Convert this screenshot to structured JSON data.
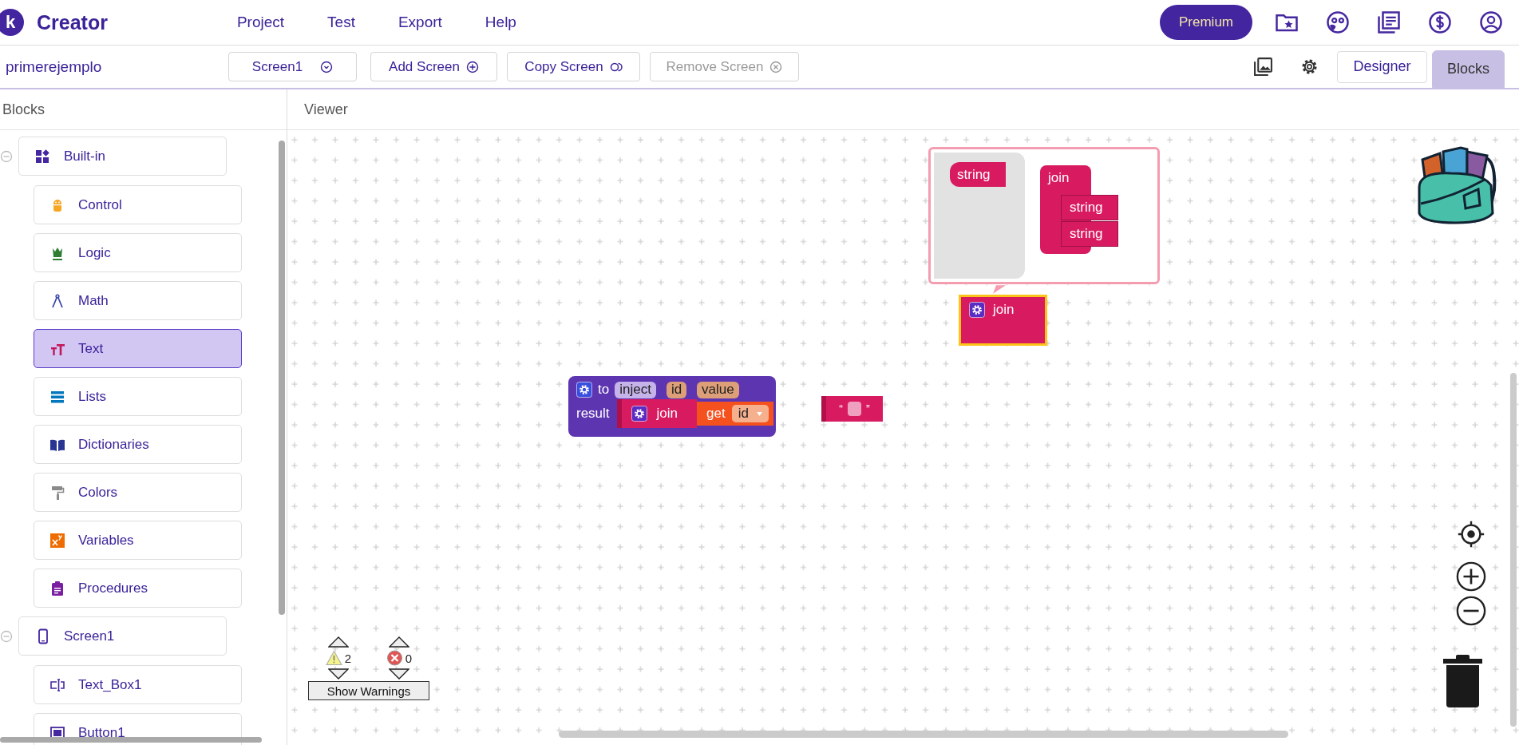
{
  "app": {
    "logo": "k",
    "name": "Creator"
  },
  "menu": [
    "Project",
    "Test",
    "Export",
    "Help"
  ],
  "premium_button": "Premium",
  "project_name": "primerejemplo",
  "screen_select": "Screen1",
  "screen_buttons": [
    {
      "label": "Add Screen",
      "kind": "add",
      "disabled": false
    },
    {
      "label": "Copy Screen",
      "kind": "copy",
      "disabled": false
    },
    {
      "label": "Remove Screen",
      "kind": "remove",
      "disabled": true
    }
  ],
  "view_tabs": [
    {
      "label": "Designer",
      "selected": false
    },
    {
      "label": "Blocks",
      "selected": true
    }
  ],
  "blocks_panel": {
    "title": "Blocks",
    "tree": [
      {
        "label": "Built-in",
        "kind": "builtin",
        "expanded": true,
        "selected": false,
        "children": [
          {
            "label": "Control",
            "kind": "control",
            "selected": false
          },
          {
            "label": "Logic",
            "kind": "logic",
            "selected": false
          },
          {
            "label": "Math",
            "kind": "math",
            "selected": false
          },
          {
            "label": "Text",
            "kind": "text",
            "selected": true
          },
          {
            "label": "Lists",
            "kind": "lists",
            "selected": false
          },
          {
            "label": "Dictionaries",
            "kind": "dictionaries",
            "selected": false
          },
          {
            "label": "Colors",
            "kind": "colors",
            "selected": false
          },
          {
            "label": "Variables",
            "kind": "variables",
            "selected": false
          },
          {
            "label": "Procedures",
            "kind": "procedures",
            "selected": false
          }
        ]
      },
      {
        "label": "Screen1",
        "kind": "screen",
        "expanded": true,
        "selected": false,
        "children": [
          {
            "label": "Text_Box1",
            "kind": "textbox",
            "selected": false
          },
          {
            "label": "Button1",
            "kind": "button",
            "selected": false
          }
        ]
      }
    ]
  },
  "viewer": {
    "title": "Viewer",
    "mutator_bubble": {
      "flyout_block": "string",
      "join_block": {
        "label": "join",
        "inputs": [
          "string",
          "string"
        ]
      }
    },
    "join_block": {
      "label": "join",
      "selected": true
    },
    "procedure_block": {
      "keyword": "to",
      "name": "inject",
      "params": [
        "id",
        "value"
      ],
      "result_label": "result",
      "join_label": "join",
      "getter": {
        "keyword": "get",
        "variable": "id"
      }
    },
    "text_block": {
      "open_quote": "“",
      "close_quote": "”"
    },
    "warnings": {
      "warning_count": "2",
      "error_count": "0",
      "button": "Show Warnings"
    }
  }
}
